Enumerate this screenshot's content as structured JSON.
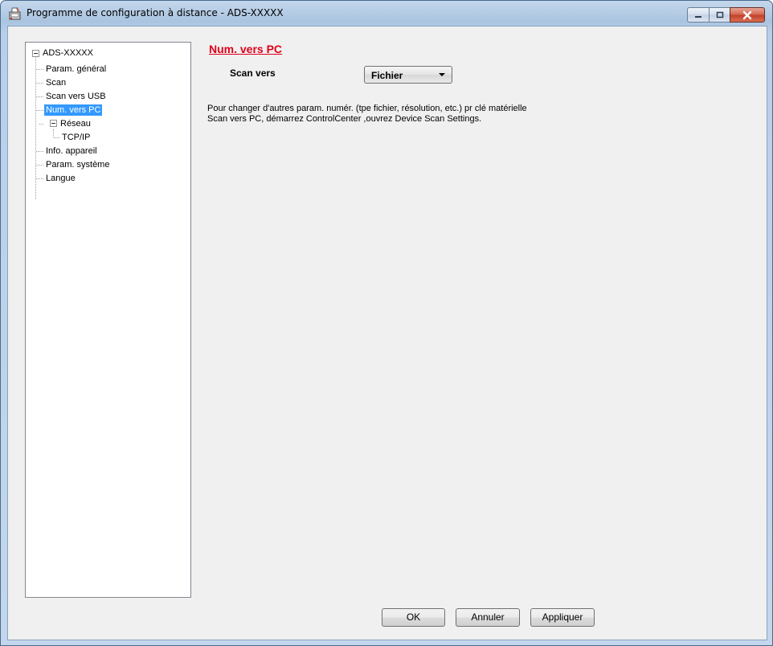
{
  "window": {
    "title": "Programme de configuration à distance - ADS-XXXXX",
    "icon": "remote-setup-app-icon"
  },
  "caption_buttons": {
    "minimize_icon": "minimize-icon",
    "maximize_icon": "maximize-icon",
    "close_icon": "close-icon"
  },
  "tree": {
    "root": "ADS-XXXXX",
    "items": [
      {
        "label": "Param. général"
      },
      {
        "label": "Scan"
      },
      {
        "label": "Scan vers USB"
      },
      {
        "label": "Num. vers PC",
        "selected": true
      },
      {
        "label": "Réseau",
        "expanded": true,
        "children": [
          {
            "label": "TCP/IP"
          }
        ]
      },
      {
        "label": "Info. appareil"
      },
      {
        "label": "Param. système"
      },
      {
        "label": "Langue"
      }
    ]
  },
  "main": {
    "section_title": "Num. vers PC",
    "scan_to_label": "Scan vers",
    "scan_to_value": "Fichier",
    "info_line1": "Pour changer d'autres param. numér. (tpe fichier, résolution, etc.) pr clé matérielle",
    "info_line2": "Scan vers PC, démarrez ControlCenter ,ouvrez Device Scan Settings."
  },
  "buttons": {
    "ok": "OK",
    "cancel": "Annuler",
    "apply": "Appliquer"
  },
  "colors": {
    "section_title": "#e0001a",
    "selection": "#3399ff",
    "window_frame": "#b9cfe8",
    "close_button": "#c3412a"
  }
}
